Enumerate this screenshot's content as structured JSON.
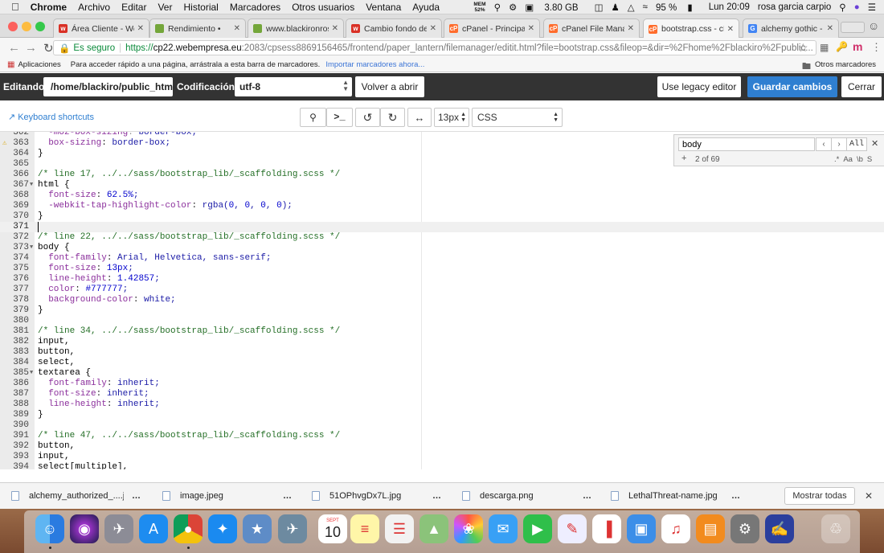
{
  "macmenu": {
    "app": "Chrome",
    "items": [
      "Archivo",
      "Editar",
      "Ver",
      "Historial",
      "Marcadores",
      "Otros usuarios",
      "Ventana",
      "Ayuda"
    ],
    "mem_label": "MEM",
    "mem": "52%",
    "storage": "3.80 GB",
    "battery": "95 %",
    "clock": "Lun 20:09",
    "user": "rosa garcia carpio"
  },
  "tabs": [
    {
      "title": "Área Cliente - Web",
      "fav": "w",
      "fav_color": "#d93025"
    },
    {
      "title": "Rendimiento •",
      "fav": "",
      "fav_color": "#74a63a"
    },
    {
      "title": "www.blackironrose",
      "fav": "",
      "fav_color": "#74a63a"
    },
    {
      "title": "Cambio fondo defa",
      "fav": "w",
      "fav_color": "#d93025"
    },
    {
      "title": "cPanel - Principal",
      "fav": "cP",
      "fav_color": "#ff6c2c"
    },
    {
      "title": "cPanel File Manage",
      "fav": "cP",
      "fav_color": "#ff6c2c"
    },
    {
      "title": "bootstrap.css - cP",
      "fav": "cP",
      "fav_color": "#ff6c2c"
    },
    {
      "title": "alchemy gothic - B",
      "fav": "G",
      "fav_color": "#4285f4"
    }
  ],
  "address": {
    "secure": "Es seguro",
    "scheme": "https://",
    "host": "cp22.webempresa.eu",
    "path": ":2083/cpsess8869156465/frontend/paper_lantern/filemanager/editit.html?file=bootstrap.css&fileop=&dir=%2Fhome%2Fblackiro%2Fpublic..."
  },
  "bookmarks": {
    "apps": "Aplicaciones",
    "hint": "Para acceder rápido a una página, arrástrala a esta barra de marcadores.",
    "import": "Importar marcadores ahora...",
    "other": "Otros marcadores"
  },
  "cpanel": {
    "editing_label": "Editando:",
    "path": "/home/blackiro/public_htm",
    "encoding_label": "Codificación:",
    "encoding": "utf-8",
    "reopen": "Volver a abrir",
    "legacy": "Use legacy editor",
    "save": "Guardar cambios",
    "close": "Cerrar"
  },
  "editorbar": {
    "shortcuts": "Keyboard shortcuts",
    "fontsize": "13px",
    "mode": "CSS"
  },
  "search": {
    "query": "body",
    "count": "2 of 69",
    "all": "All",
    "opts": [
      ".*",
      "Aa",
      "\\b",
      "S"
    ]
  },
  "code_lines": [
    {
      "n": "362",
      "t": "  -moz-box-sizing: border-box;",
      "partial": true
    },
    {
      "n": "363",
      "t": "  box-sizing: border-box;",
      "warn": true
    },
    {
      "n": "364",
      "t": "}"
    },
    {
      "n": "365",
      "t": ""
    },
    {
      "n": "366",
      "t": "/* line 17, ../../sass/bootstrap_lib/_scaffolding.scss */"
    },
    {
      "n": "367",
      "t": "html {",
      "fold": true
    },
    {
      "n": "368",
      "t": "  font-size: 62.5%;"
    },
    {
      "n": "369",
      "t": "  -webkit-tap-highlight-color: rgba(0, 0, 0, 0);"
    },
    {
      "n": "370",
      "t": "}"
    },
    {
      "n": "371",
      "t": "",
      "cur": true
    },
    {
      "n": "372",
      "t": "/* line 22, ../../sass/bootstrap_lib/_scaffolding.scss */"
    },
    {
      "n": "373",
      "t": "body {",
      "fold": true
    },
    {
      "n": "374",
      "t": "  font-family: Arial, Helvetica, sans-serif;"
    },
    {
      "n": "375",
      "t": "  font-size: 13px;"
    },
    {
      "n": "376",
      "t": "  line-height: 1.42857;"
    },
    {
      "n": "377",
      "t": "  color: #777777;"
    },
    {
      "n": "378",
      "t": "  background-color: white;"
    },
    {
      "n": "379",
      "t": "}"
    },
    {
      "n": "380",
      "t": ""
    },
    {
      "n": "381",
      "t": "/* line 34, ../../sass/bootstrap_lib/_scaffolding.scss */"
    },
    {
      "n": "382",
      "t": "input,"
    },
    {
      "n": "383",
      "t": "button,"
    },
    {
      "n": "384",
      "t": "select,"
    },
    {
      "n": "385",
      "t": "textarea {",
      "fold": true
    },
    {
      "n": "386",
      "t": "  font-family: inherit;"
    },
    {
      "n": "387",
      "t": "  font-size: inherit;"
    },
    {
      "n": "388",
      "t": "  line-height: inherit;"
    },
    {
      "n": "389",
      "t": "}"
    },
    {
      "n": "390",
      "t": ""
    },
    {
      "n": "391",
      "t": "/* line 47, ../../sass/bootstrap_lib/_scaffolding.scss */"
    },
    {
      "n": "392",
      "t": "button,"
    },
    {
      "n": "393",
      "t": "input,"
    },
    {
      "n": "394",
      "t": "select[multiple],"
    }
  ],
  "downloads": {
    "files": [
      "alchemy_authorized_....jpg",
      "image.jpeg",
      "51OPhvgDx7L.jpg",
      "descarga.png",
      "LethalThreat-name.jpg"
    ],
    "show_all": "Mostrar todas"
  },
  "dock": {
    "calendar_month": "SEPT",
    "calendar_day": "10"
  }
}
